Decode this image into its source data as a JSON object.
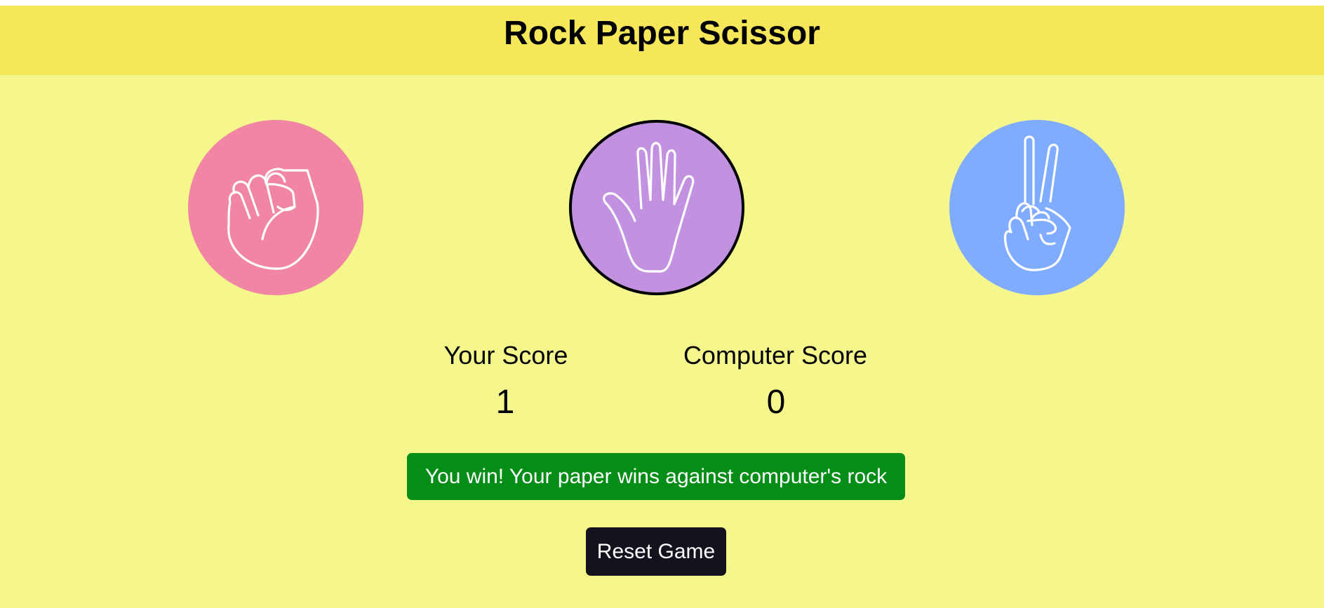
{
  "header": {
    "title": "Rock Paper Scissor"
  },
  "choices": [
    {
      "name": "rock",
      "icon": "rock-fist-icon",
      "color": "#f086a3",
      "selected": false
    },
    {
      "name": "paper",
      "icon": "paper-hand-icon",
      "color": "#c292e0",
      "selected": true
    },
    {
      "name": "scissors",
      "icon": "scissors-hand-icon",
      "color": "#80acff",
      "selected": false
    }
  ],
  "scores": {
    "user_label": "Your Score",
    "user_value": "1",
    "computer_label": "Computer Score",
    "computer_value": "0"
  },
  "result": {
    "message": "You win! Your paper wins against computer's rock",
    "color": "#058e17"
  },
  "controls": {
    "reset_label": "Reset Game"
  }
}
